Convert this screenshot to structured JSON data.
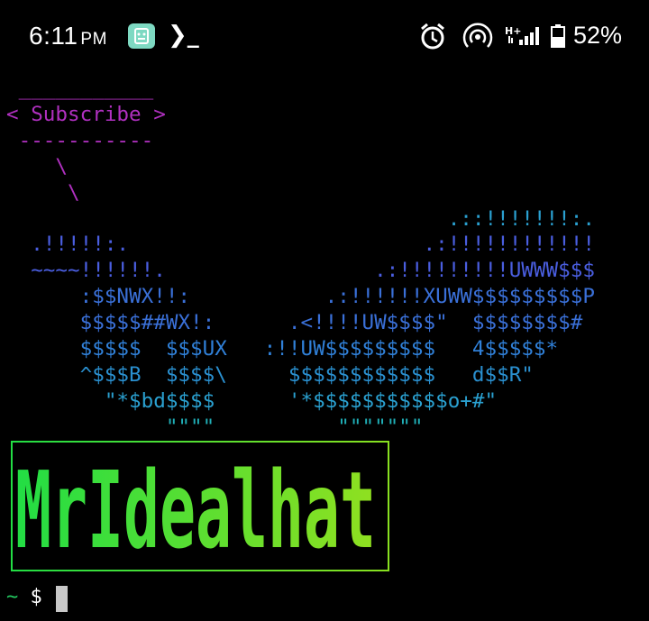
{
  "status_bar": {
    "time": "6:11",
    "ampm": "PM",
    "battery_percent": "52%",
    "icons": [
      "app-notification-icon",
      "terminal-prompt-icon",
      "alarm-icon",
      "hotspot-icon",
      "signal-icon",
      "battery-icon"
    ],
    "signal_network_label": "H+"
  },
  "terminal": {
    "bubble_top": " ___________",
    "bubble_text": "< Subscribe >",
    "bubble_bottom": " -----------",
    "bubble_tail_1": "    \\",
    "bubble_tail_2": "     \\",
    "art_lines": [
      "                                    .::!!!!!!!:.",
      "  .!!!!!:.                        .:!!!!!!!!!!!!",
      "  ~~~~!!!!!!.                 .:!!!!!!!!!UWWW$$$",
      "      :$$NWX!!:           .:!!!!!!XUWW$$$$$$$$$P",
      "      $$$$$##WX!:      .<!!!!UW$$$$\"  $$$$$$$$#",
      "      $$$$$  $$$UX   :!!UW$$$$$$$$$   4$$$$$*",
      "      ^$$$B  $$$$\\     $$$$$$$$$$$$   d$$R\"",
      "        \"*$bd$$$$      '*$$$$$$$$$$$o+#\"",
      "             \"\"\"\"          \"\"\"\"\"\"\""
    ],
    "banner_text": "MrIdealhat",
    "prompt_tilde": "~",
    "prompt_symbol": "$"
  },
  "colors": {
    "bubble": "#b030c0",
    "art_gradient": [
      "#8a2be2",
      "#5050e0",
      "#3a70d8",
      "#2a9ad0",
      "#20b0b8"
    ],
    "banner_gradient": [
      "#22dd44",
      "#90e020"
    ],
    "prompt_tilde": "#22c55e",
    "cursor": "#c8c8c8"
  }
}
